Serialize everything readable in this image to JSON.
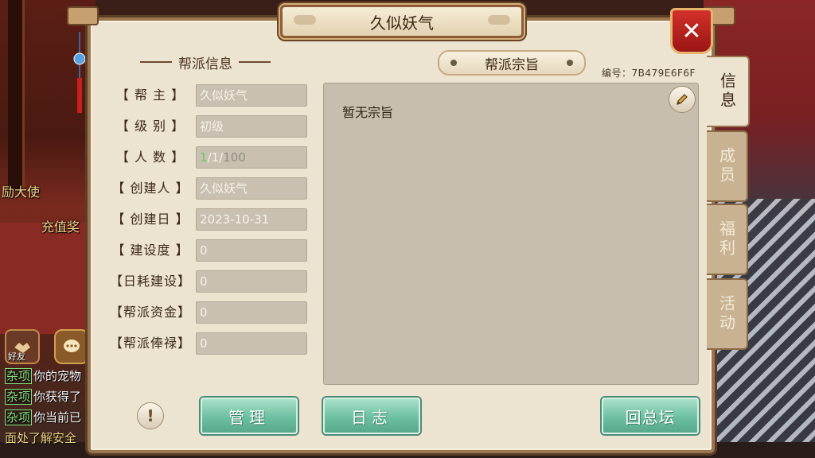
{
  "dialog": {
    "title": "久似妖气",
    "close_label": "✕"
  },
  "left_section": {
    "title": "帮派信息",
    "rows": [
      {
        "label": "【 帮 主 】",
        "value": "久似妖气"
      },
      {
        "label": "【 级 别 】",
        "value": "初级"
      },
      {
        "label": "【 人 数 】",
        "value_online": "1",
        "value_sep1": "/",
        "value_current": "1",
        "value_sep2": "/",
        "value_max": "100"
      },
      {
        "label": "【 创建人 】",
        "value": "久似妖气"
      },
      {
        "label": "【 创建日 】",
        "value": "2023-10-31"
      },
      {
        "label": "【 建设度 】",
        "value": "0"
      },
      {
        "label": "【日耗建设】",
        "value": "0"
      },
      {
        "label": "【帮派资金】",
        "value": "0"
      },
      {
        "label": "【帮派俸禄】",
        "value": "0"
      }
    ]
  },
  "doctrine": {
    "title": "帮派宗旨",
    "serial": "编号：7B479E6F6F",
    "text": "暂无宗旨"
  },
  "tabs": [
    {
      "label": "信息",
      "active": true
    },
    {
      "label": "成员",
      "active": false
    },
    {
      "label": "福利",
      "active": false
    },
    {
      "label": "活动",
      "active": false
    }
  ],
  "buttons": {
    "manage": "管理",
    "log": "日志",
    "return": "回总坛",
    "info_icon": "!"
  },
  "hud": {
    "label_1": "励大使",
    "label_2": "充值奖",
    "friend": "好友",
    "chat": [
      {
        "tag": "杂项",
        "text": "你的宠物"
      },
      {
        "tag": "杂项",
        "text": "你获得了"
      },
      {
        "tag": "杂项",
        "text": "你当前已"
      },
      {
        "tag": "",
        "text": "面处了解安全"
      }
    ]
  },
  "colors": {
    "accent_green": "#5fd15f",
    "button_teal": "#6cc0a2",
    "close_red": "#c52a24",
    "panel_bg": "#ece3d0"
  }
}
